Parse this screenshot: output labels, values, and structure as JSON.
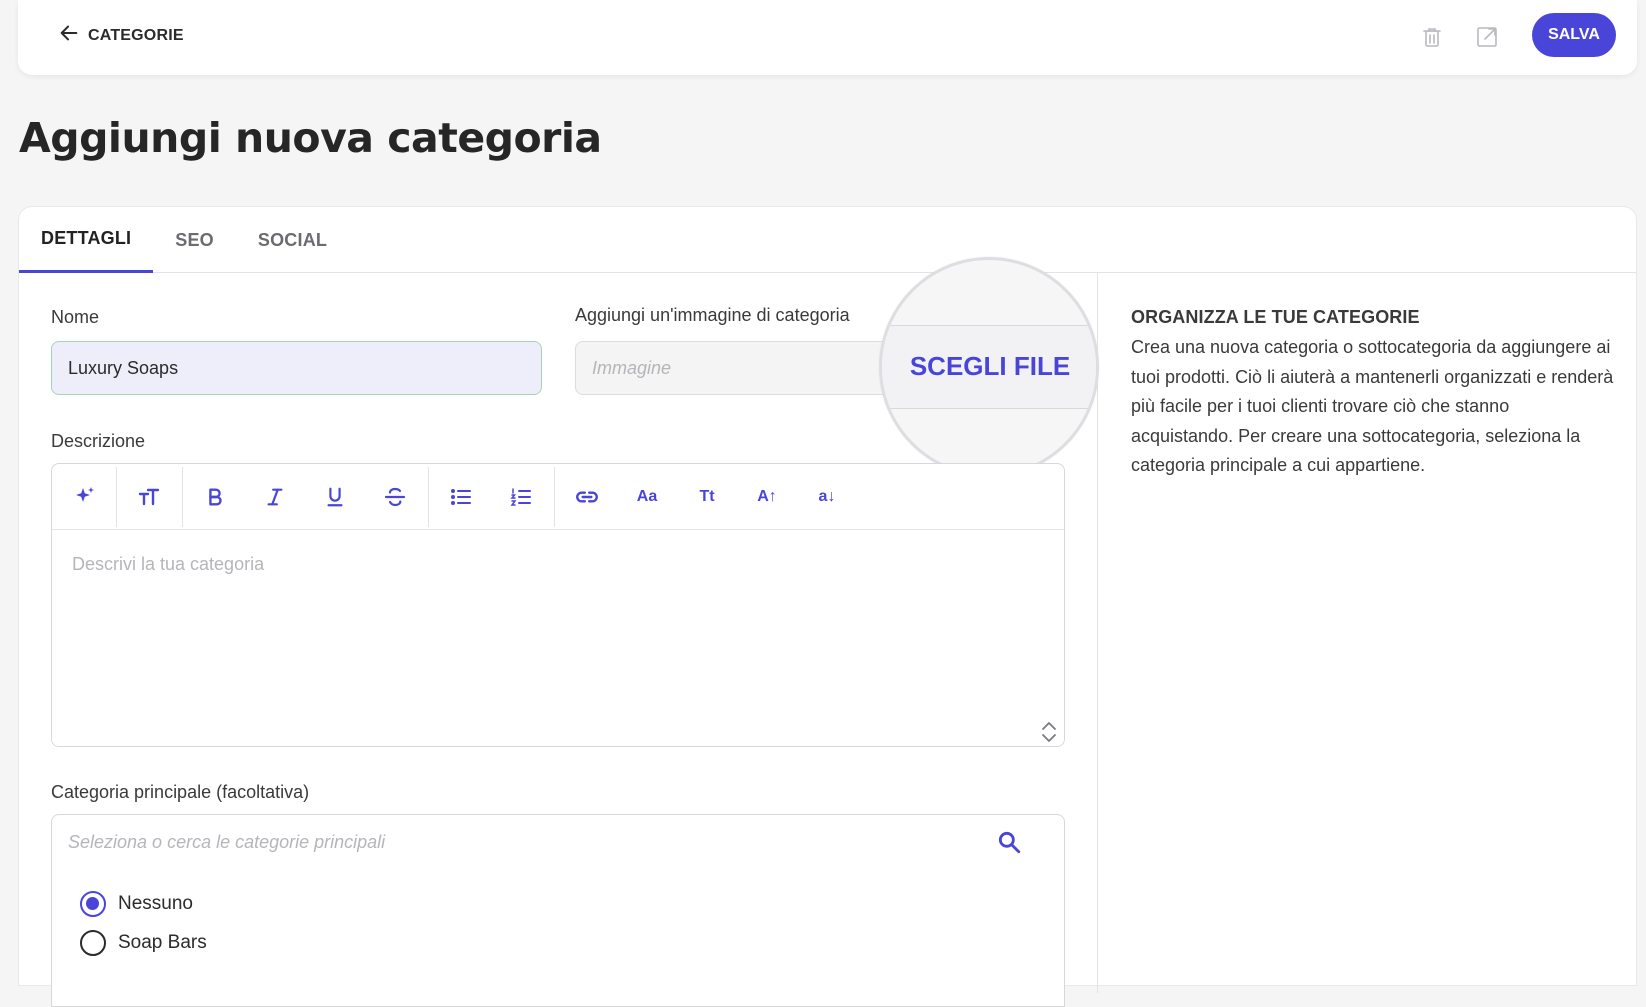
{
  "header": {
    "back_label": "CATEGORIE",
    "save_label": "SALVA"
  },
  "page": {
    "title": "Aggiungi nuova categoria"
  },
  "tabs": [
    {
      "label": "DETTAGLI",
      "active": true
    },
    {
      "label": "SEO",
      "active": false
    },
    {
      "label": "SOCIAL",
      "active": false
    }
  ],
  "form": {
    "name_label": "Nome",
    "name_value": "Luxury Soaps",
    "image_label": "Aggiungi un'immagine di categoria",
    "image_placeholder": "Immagine",
    "choose_file_label": "SCEGLI FILE",
    "description_label": "Descrizione",
    "description_placeholder": "Descrivi la tua categoria",
    "parent_label": "Categoria principale (facoltativa)",
    "parent_placeholder": "Seleziona o cerca le categorie principali",
    "parent_options": [
      {
        "label": "Nessuno",
        "selected": true
      },
      {
        "label": "Soap Bars",
        "selected": false
      }
    ]
  },
  "toolbar_icons": [
    "sparkle-icon",
    "text-size-icon",
    "bold-icon",
    "italic-icon",
    "underline-icon",
    "strikethrough-icon",
    "bullet-list-icon",
    "numbered-list-icon",
    "link-icon",
    "font-case-icon",
    "title-case-icon",
    "uppercase-icon",
    "lowercase-icon"
  ],
  "toolbar_glyphs": {
    "font_case": "Aa",
    "title_case": "Tt",
    "uppercase": "A↑",
    "lowercase": "a↓"
  },
  "sidebar": {
    "title": "ORGANIZZA LE TUE CATEGORIE",
    "text": "Crea una nuova categoria o sottocategoria da aggiungere ai tuoi prodotti. Ciò li aiuterà a mantenerli organizzati e renderà più facile per i tuoi clienti trovare ciò che stanno acquistando. Per creare una sottocategoria, seleziona la categoria principale a cui appartiene."
  },
  "colors": {
    "accent": "#4a45d9",
    "background": "#f5f5f6",
    "input_highlight": "#eeeefb"
  }
}
